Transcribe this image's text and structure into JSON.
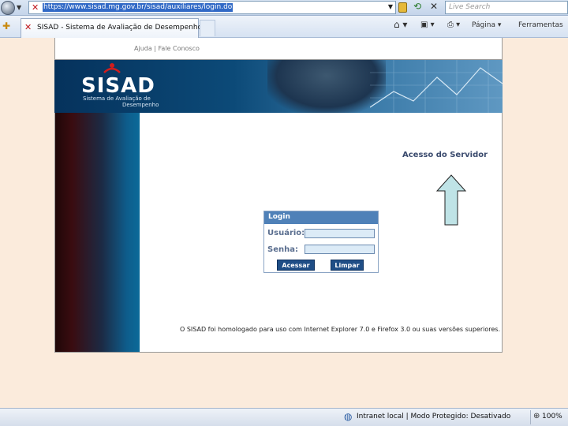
{
  "browser": {
    "url": "https://www.sisad.mg.gov.br/sisad/auxiliares/login.do",
    "search_placeholder": "Live Search",
    "tab_title": "SISAD - Sistema de Avaliação de Desempenho",
    "commands": {
      "page": "Página",
      "tools": "Ferramentas"
    }
  },
  "page": {
    "help_links": "Ajuda | Fale Conosco",
    "logo": {
      "text": "SISAD",
      "subtitle_line1": "Sistema de Avaliação de",
      "subtitle_line2": "Desempenho"
    },
    "acesso_title": "Acesso do Servidor",
    "login": {
      "title": "Login",
      "user_label": "Usuário:",
      "password_label": "Senha:",
      "user_value": "",
      "password_value": "",
      "submit_label": "Acessar",
      "clear_label": "Limpar"
    },
    "compat_note": "O SISAD foi homologado para uso com Internet Explorer 7.0 e Firefox 3.0 ou suas versões superiores."
  },
  "statusbar": {
    "zone_text": "Intranet local | Modo Protegido: Desativado",
    "zoom": "100%"
  },
  "colors": {
    "page_background": "#fbebdc",
    "banner": "#0c4a78",
    "button": "#1f4e86",
    "arrow_fill": "#bfe3e6"
  },
  "icons": [
    "nav-back-icon",
    "favicon-icon",
    "lock-icon",
    "refresh-icon",
    "stop-icon",
    "favorites-star-icon",
    "home-icon",
    "feeds-icon",
    "print-icon",
    "globe-icon",
    "zoom-icon",
    "up-arrow-icon"
  ]
}
